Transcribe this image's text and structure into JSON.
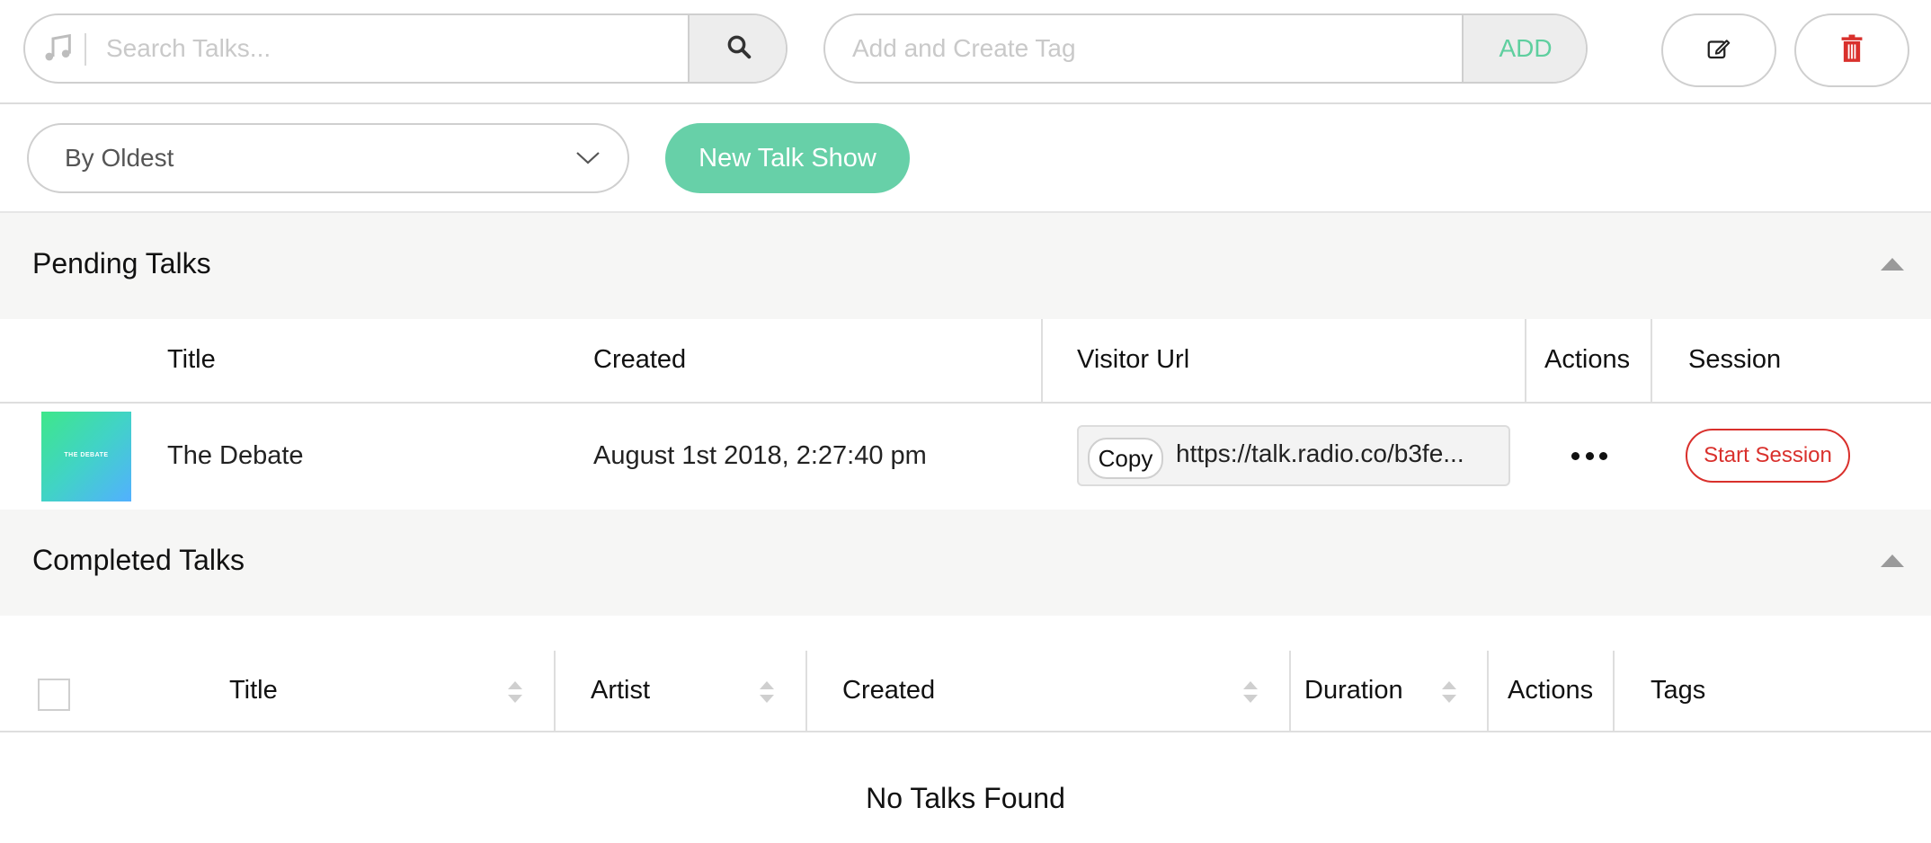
{
  "search": {
    "placeholder": "Search Talks...",
    "value": ""
  },
  "tag": {
    "placeholder": "Add and Create Tag",
    "add_label": "ADD"
  },
  "sort": {
    "selected": "By Oldest"
  },
  "new_show_label": "New Talk Show",
  "pending": {
    "title": "Pending Talks",
    "columns": [
      "Title",
      "Created",
      "Visitor Url",
      "Actions",
      "Session"
    ],
    "rows": [
      {
        "thumb_title": "THE DEBATE",
        "title": "The Debate",
        "created": "August 1st 2018, 2:27:40 pm",
        "copy_label": "Copy",
        "url": "https://talk.radio.co/b3fe...",
        "session_label": "Start Session"
      }
    ]
  },
  "completed": {
    "title": "Completed Talks",
    "columns": [
      "Title",
      "Artist",
      "Created",
      "Duration",
      "Actions",
      "Tags"
    ],
    "empty_text": "No Talks Found"
  },
  "colors": {
    "accent_green": "#67d0a8",
    "add_text": "#5fcf9f",
    "danger": "#d9302c",
    "section_bg": "#f6f6f5"
  },
  "icons": {
    "search_prefix": "music-note-icon",
    "search_button": "magnifier-icon",
    "edit": "edit-icon",
    "delete": "trash-icon",
    "sort_dropdown": "chevron-down-icon",
    "section_toggle": "caret-up-icon",
    "row_actions": "ellipsis-icon",
    "column_sort": "sort-arrows-icon"
  }
}
